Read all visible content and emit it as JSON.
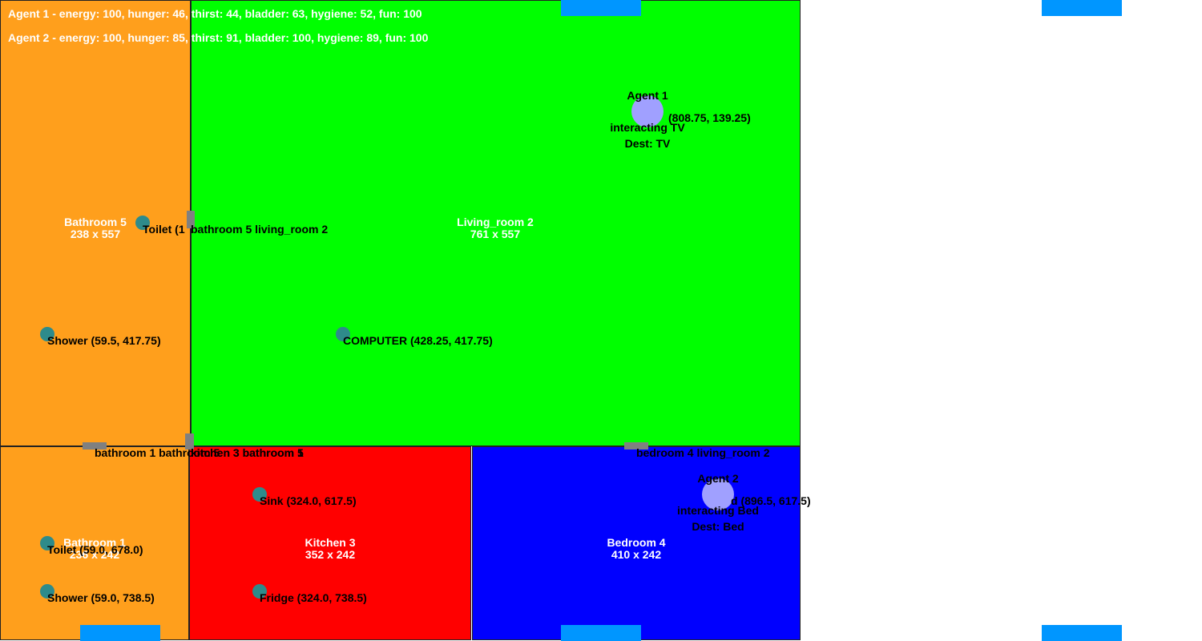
{
  "colors": {
    "bathroom": "#ff9f1c",
    "living_room": "#00ff00",
    "kitchen": "#ff0000",
    "bedroom": "#0000ff",
    "object_dot": "#2e8b8b",
    "agent": "#a0a0ff",
    "door": "#808080",
    "marker": "#0096ff"
  },
  "hud": {
    "agent1_stats": "Agent 1 - energy: 100, hunger: 46, thirst: 44, bladder: 63, hygiene: 52, fun: 100",
    "agent2_stats": "Agent 2 - energy: 100, hunger: 85, thirst: 91, bladder: 100, hygiene: 89, fun: 100"
  },
  "rooms": {
    "bathroom5": {
      "name": "Bathroom 5",
      "size": "238 x 557"
    },
    "living_room2": {
      "name": "Living_room 2",
      "size": "761 x 557"
    },
    "bathroom1": {
      "name": "Bathroom 1",
      "size": "236 x 242"
    },
    "kitchen3": {
      "name": "Kitchen 3",
      "size": "352 x 242"
    },
    "bedroom4": {
      "name": "Bedroom 4",
      "size": "410 x 242"
    }
  },
  "objects": {
    "toilet_b5": "Toilet (1",
    "shower_b5": "Shower (59.5, 417.75)",
    "computer": "COMPUTER (428.25, 417.75)",
    "sink": "Sink (324.0, 617.5)",
    "fridge": "Fridge (324.0, 738.5)",
    "toilet_b1": "Toilet (59.0, 678.0)",
    "shower_b1": "Shower (59.0, 738.5)"
  },
  "doors": {
    "b5_lr2": "bathroom 5 living_room 2",
    "b1_b5": "bathroom 1 bathroom 5",
    "k3_b5": "kitchen 3 bathroom 5",
    "k3_b1": "kitchen 3 bathroom 1",
    "b4_lr2": "bedroom 4 living_room 2"
  },
  "agents": {
    "agent1": {
      "name": "Agent 1",
      "coord": "(808.75, 139.25)",
      "action": "interacting TV",
      "dest": "Dest: TV"
    },
    "agent2": {
      "name": "Agent 2",
      "coord": "d (896.5, 617.5)",
      "action": "interacting Bed",
      "dest": "Dest: Bed"
    }
  }
}
